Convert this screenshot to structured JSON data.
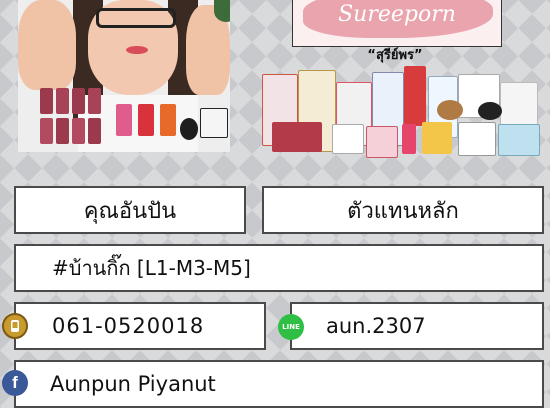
{
  "banner": {
    "script_text": "Sureeporn",
    "brand_label": "“สุรีย์พร”"
  },
  "cards": {
    "name": "คุณอันปัน",
    "role": "ตัวแทนหลัก",
    "branch": "#บ้านกิ๊ก [L1-M3-M5]",
    "phone": "061-0520018",
    "line_id": "aun.2307",
    "facebook": "Aunpun Piyanut"
  },
  "icons": {
    "phone": "phone-icon",
    "line": "line-icon",
    "facebook": "facebook-icon"
  },
  "colors": {
    "line_green": "#2fbf44",
    "facebook_blue": "#3b5998",
    "phone_gold": "#c99a2e",
    "banner_pink": "#e9a4ad"
  }
}
